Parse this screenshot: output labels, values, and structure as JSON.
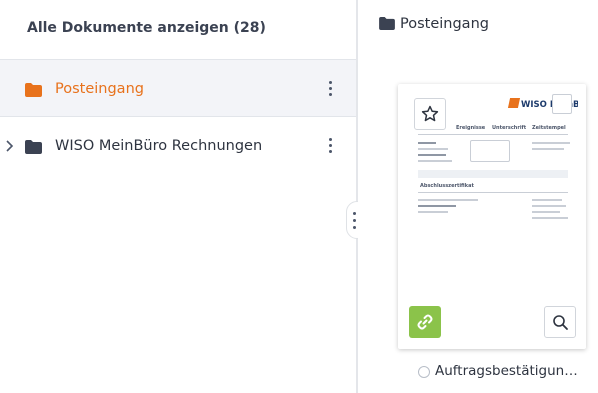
{
  "sidebar": {
    "all_documents_label": "Alle Dokumente anzeigen (28)",
    "folders": [
      {
        "label": "Posteingang",
        "selected": true,
        "icon": "folder-icon",
        "color": "#e8721c"
      },
      {
        "label": "WISO MeinBüro Rechnungen",
        "selected": false,
        "icon": "folder-icon",
        "color": "#3b4252"
      }
    ]
  },
  "main": {
    "breadcrumb": {
      "label": "Posteingang",
      "icon": "folder-icon"
    },
    "document": {
      "name": "Auftragsbestätigung_...",
      "thumbnail": {
        "logo_text": "WISO MeinB",
        "headers": [
          "Ereignisse",
          "Unterschrift",
          "Zeitstempel"
        ],
        "section_title": "Abschlusszertifikat"
      }
    }
  },
  "colors": {
    "accent": "#e8721c",
    "link_button": "#8bc34a",
    "selected_row_bg": "#f3f4f8",
    "text": "#2e3440"
  }
}
